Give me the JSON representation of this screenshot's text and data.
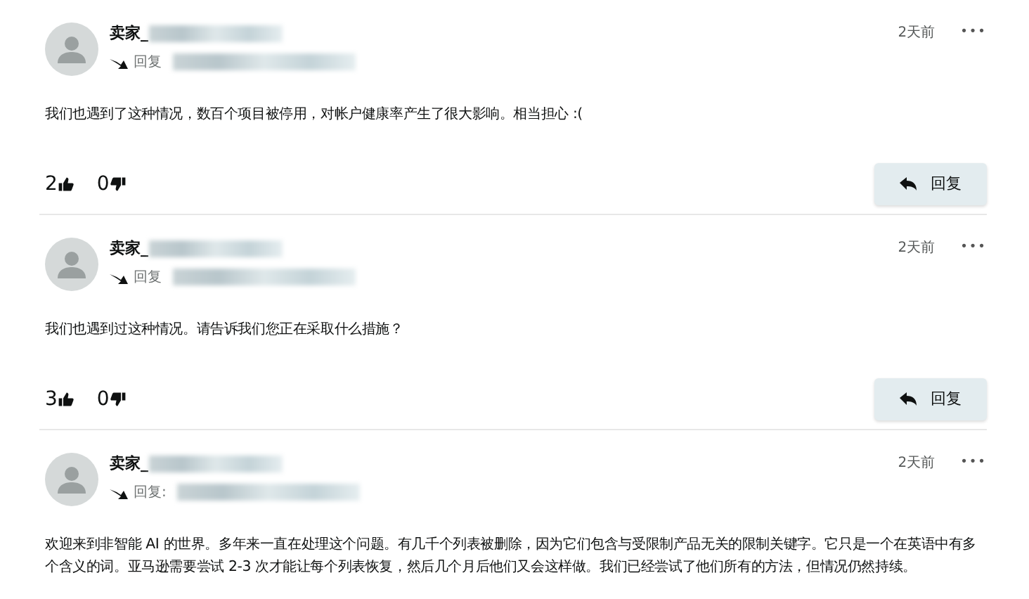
{
  "posts": [
    {
      "author": "卖家_",
      "redacted": true,
      "reply_to_label": "回复",
      "time": "2天前",
      "menu": "•••",
      "body": "我们也遇到了这种情况，数百个项目被停用，对帐户健康率产生了很大影响。相当担心 :(",
      "upvotes": "2",
      "downvotes": "0",
      "reply_button": "回复"
    },
    {
      "author": "卖家_",
      "redacted": true,
      "reply_to_label": "回复",
      "time": "2天前",
      "menu": "•••",
      "body": "我们也遇到过这种情况。请告诉我们您正在采取什么措施？",
      "upvotes": "3",
      "downvotes": "0",
      "reply_button": "回复"
    },
    {
      "author": "卖家_",
      "redacted": true,
      "reply_to_label": "回复:",
      "time": "2天前",
      "menu": "•••",
      "body": "欢迎来到非智能 AI 的世界。多年来一直在处理这个问题。有几千个列表被删除，因为它们包含与受限制产品无关的限制关键字。它只是一个在英语中有多个含义的词。亚马逊需要尝试 2-3 次才能让每个列表恢复，然后几个月后他们又会这样做。我们已经尝试了他们所有的方法，但情况仍然持续。"
    }
  ]
}
